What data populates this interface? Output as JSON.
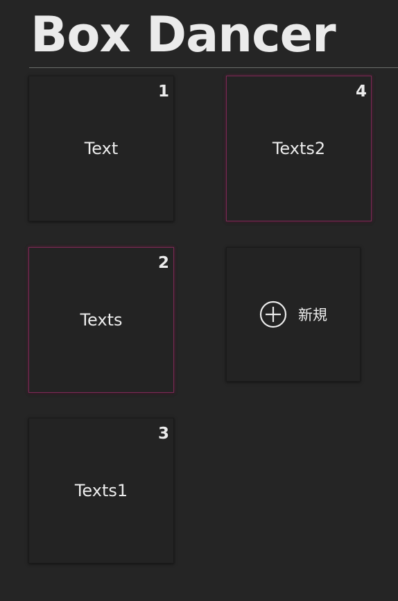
{
  "app": {
    "title": "Box Dancer"
  },
  "boxes": [
    {
      "number": "1",
      "label": "Text"
    },
    {
      "number": "2",
      "label": "Texts"
    },
    {
      "number": "3",
      "label": "Texts1"
    },
    {
      "number": "4",
      "label": "Texts2"
    }
  ],
  "new_box": {
    "label": "新規",
    "icon": "plus-circle-icon"
  },
  "colors": {
    "background": "#252525",
    "card": "#232323",
    "selected_border": "#7a2a55",
    "text": "#ececec"
  }
}
